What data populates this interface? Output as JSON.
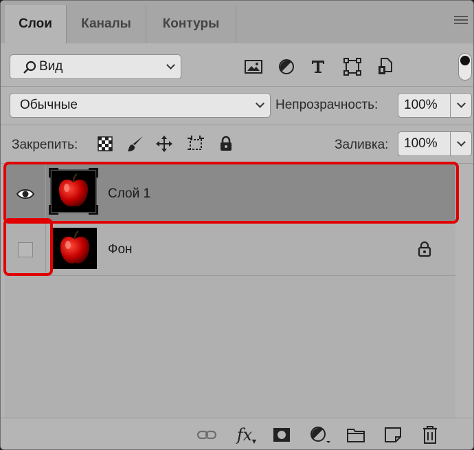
{
  "tabs": [
    {
      "label": "Слои",
      "active": true
    },
    {
      "label": "Каналы",
      "active": false
    },
    {
      "label": "Контуры",
      "active": false
    }
  ],
  "filter": {
    "label": "Вид",
    "icons": [
      "image-filter-icon",
      "adjustment-filter-icon",
      "type-filter-icon",
      "shape-filter-icon",
      "smart-object-filter-icon"
    ]
  },
  "blend": {
    "mode": "Обычные",
    "opacity_label": "Непрозрачность:",
    "opacity_value": "100%"
  },
  "lock": {
    "label": "Закрепить:",
    "icons": [
      "lock-transparent-icon",
      "lock-image-icon",
      "lock-position-icon",
      "lock-artboard-icon",
      "lock-all-icon"
    ],
    "fill_label": "Заливка:",
    "fill_value": "100%"
  },
  "layers": [
    {
      "name": "Слой 1",
      "visible": true,
      "selected": true,
      "locked": false
    },
    {
      "name": "Фон",
      "visible": false,
      "selected": false,
      "locked": true
    }
  ],
  "bottom_icons": [
    "link-layers-icon",
    "fx-icon",
    "add-mask-icon",
    "adjustment-layer-icon",
    "group-folder-icon",
    "new-layer-icon",
    "delete-layer-icon"
  ],
  "fx_label": "fx",
  "colors": {
    "highlight": "#e00000",
    "selected_row": "#8a8a8a",
    "panel": "#b5b5b5"
  }
}
